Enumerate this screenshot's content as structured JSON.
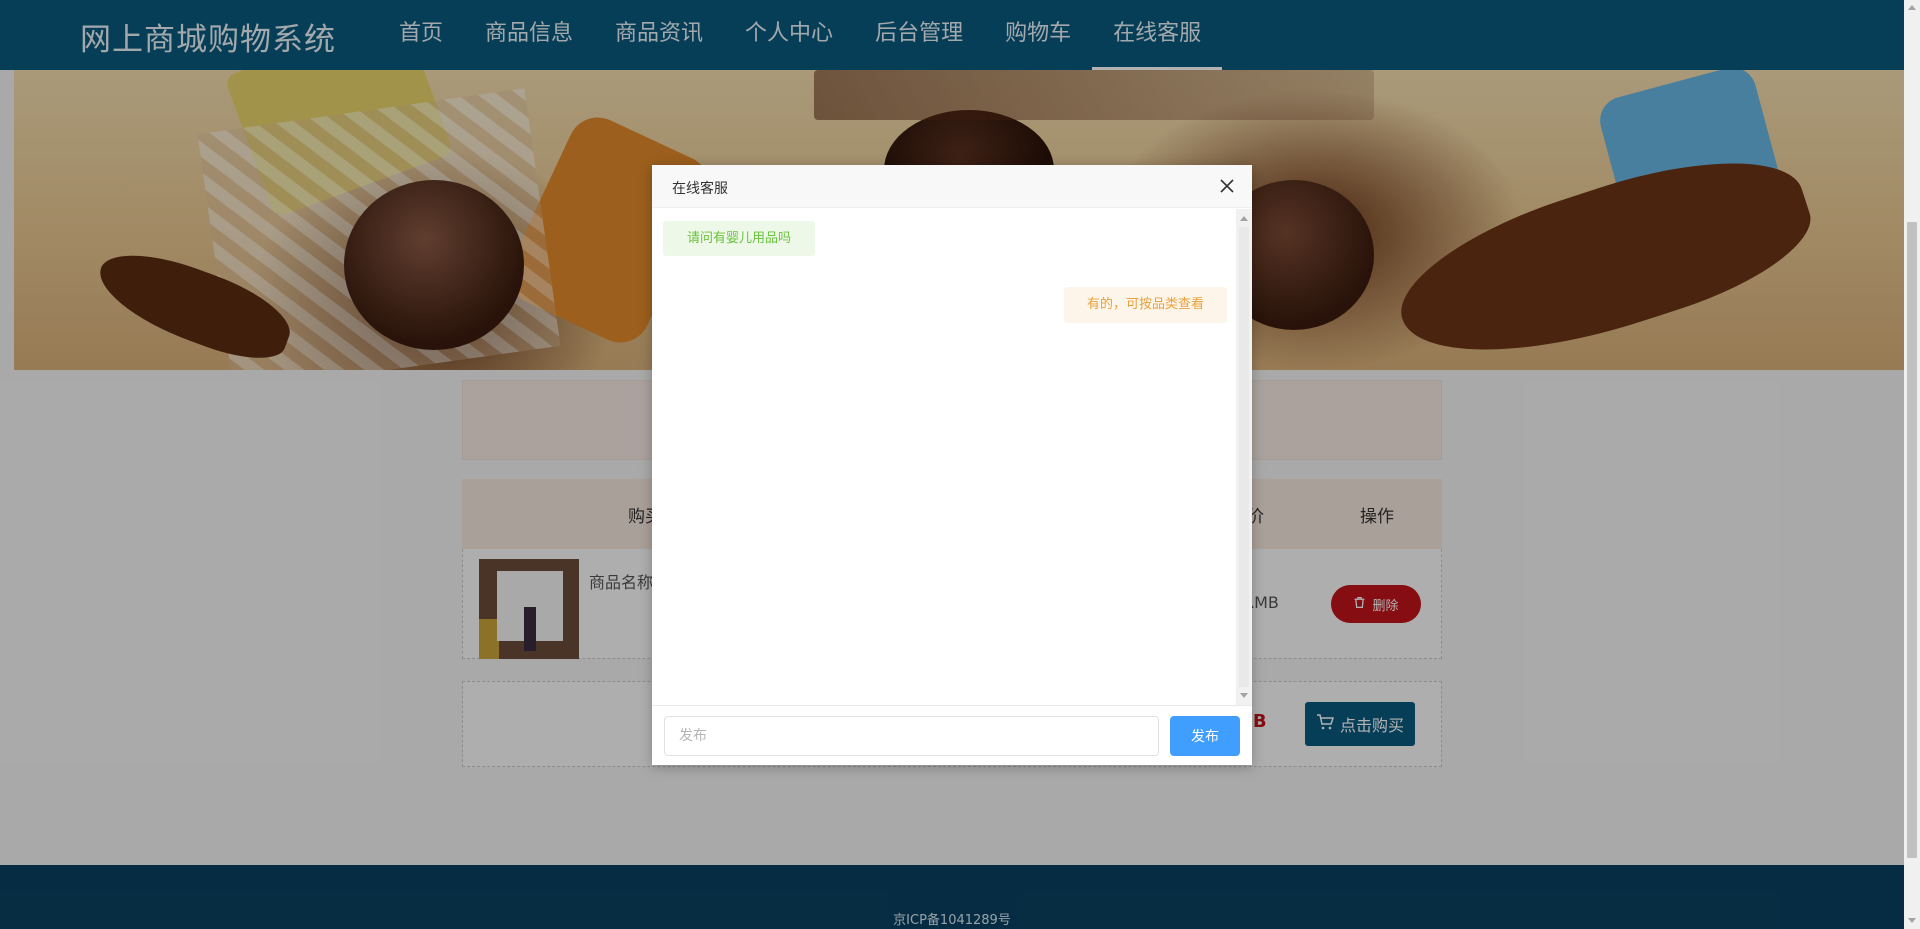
{
  "app": {
    "title": "网上商城购物系统"
  },
  "nav": {
    "items": [
      {
        "label": "首页"
      },
      {
        "label": "商品信息"
      },
      {
        "label": "商品资讯"
      },
      {
        "label": "个人中心"
      },
      {
        "label": "后台管理"
      },
      {
        "label": "购物车"
      },
      {
        "label": "在线客服"
      }
    ],
    "active": "在线客服"
  },
  "cart": {
    "header": {
      "buy": "购买",
      "price": "价",
      "operation": "操作"
    },
    "rows": [
      {
        "name": "商品名称",
        "price": "RMB",
        "delete_label": "删除"
      }
    ],
    "total": "MB",
    "buy_label": "点击购买"
  },
  "dialog": {
    "title": "在线客服",
    "messages": [
      {
        "side": "left",
        "text": "请问有婴儿用品吗"
      },
      {
        "side": "right",
        "text": "有的，可按品类查看"
      }
    ],
    "input_placeholder": "发布",
    "send_label": "发布"
  },
  "footer": {
    "text": "京ICP备1041289号"
  },
  "colors": {
    "nav_bg": "#0a5a7e",
    "footer_bg": "#0a4060",
    "delete": "#c0141a",
    "send": "#409eff",
    "msg_left_text": "#67c23a",
    "msg_right_text": "#e6a23c"
  }
}
